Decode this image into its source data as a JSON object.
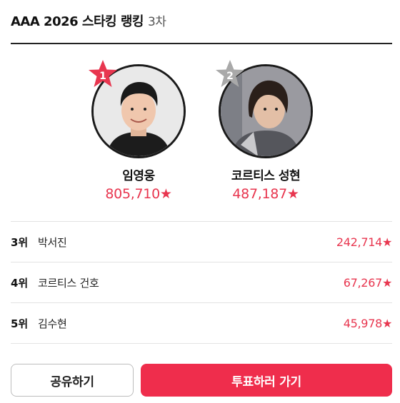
{
  "header": {
    "title": "AAA 2026 스타킹 랭킹",
    "round": "3차"
  },
  "podium": [
    {
      "rank": "1",
      "name": "임영웅",
      "votes": "805,710★",
      "badge_color": "#e8364f"
    },
    {
      "rank": "2",
      "name": "코르티스 성현",
      "votes": "487,187★",
      "badge_color": "#a9a9a9"
    }
  ],
  "ranking": [
    {
      "rank": "3위",
      "name": "박서진",
      "votes": "242,714★"
    },
    {
      "rank": "4위",
      "name": "코르티스 건호",
      "votes": "67,267★"
    },
    {
      "rank": "5위",
      "name": "김수현",
      "votes": "45,978★"
    }
  ],
  "buttons": {
    "share": "공유하기",
    "vote": "투표하러 가기"
  },
  "colors": {
    "accent": "#ef2d4c",
    "vote_text": "#e8364f"
  }
}
